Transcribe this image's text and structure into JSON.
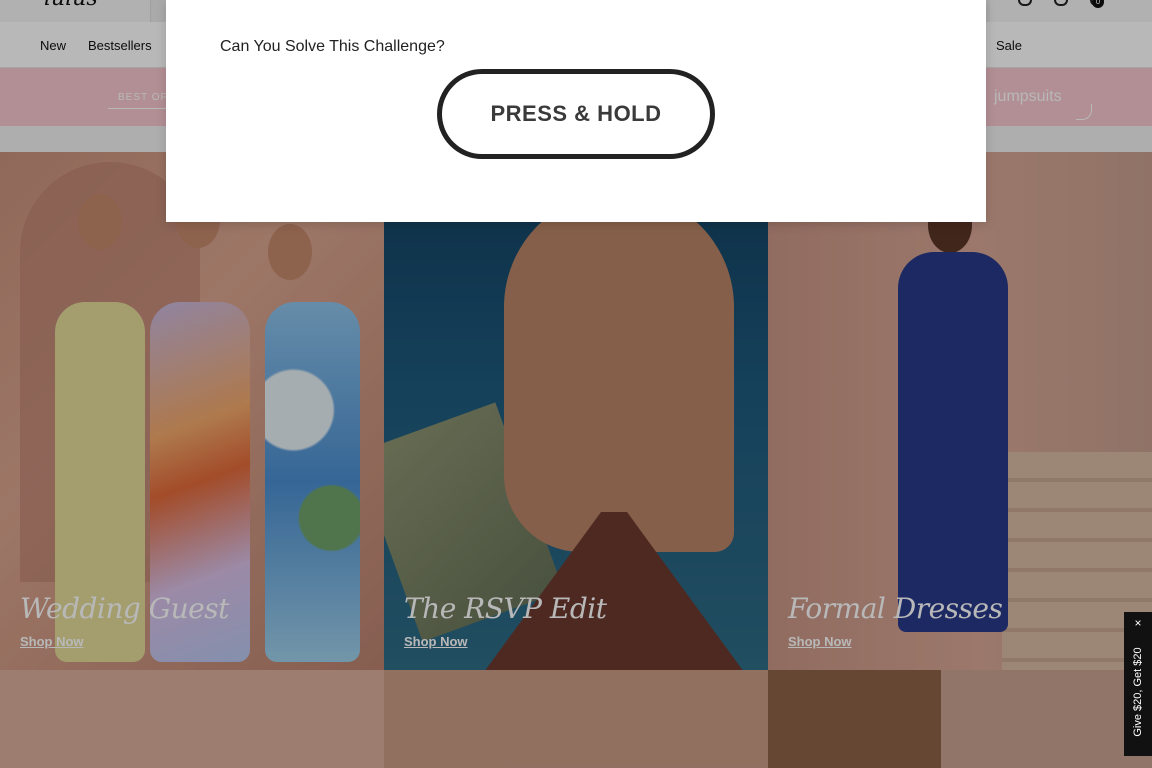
{
  "nav": {
    "items": [
      {
        "label": "New"
      },
      {
        "label": "Bestsellers"
      },
      {
        "label": "Sale"
      }
    ]
  },
  "promo": {
    "left_text": "BEST OF",
    "right_text": "jumpsuits"
  },
  "header": {
    "cart_count": "0"
  },
  "tiles": [
    {
      "title": "Wedding Guest",
      "link": "Shop Now"
    },
    {
      "title": "The RSVP Edit",
      "link": "Shop Now"
    },
    {
      "title": "Formal Dresses",
      "link": "Shop Now"
    }
  ],
  "modal": {
    "title": "Can You Solve This Challenge?",
    "button_label": "PRESS & HOLD"
  },
  "side_tab": {
    "text": "Give $20, Get $20",
    "close_icon": "×"
  },
  "icons": [
    "account-icon",
    "search-icon",
    "cart-icon",
    "close-icon"
  ]
}
